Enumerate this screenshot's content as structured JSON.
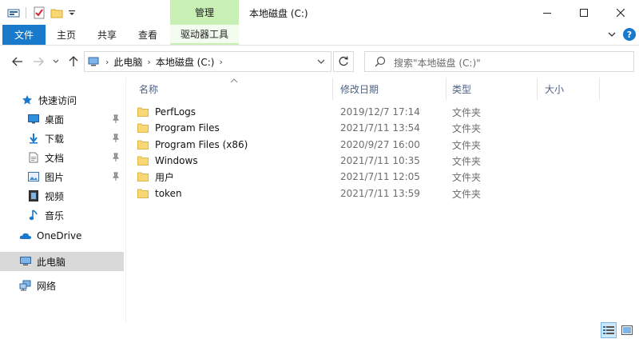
{
  "colors": {
    "file_tab": "#1979ca",
    "manage_tab": "#c8f0b4",
    "selected_item": "#d9d9d9",
    "folder_yellow": "#f8d775",
    "column_header": "#4d6082"
  },
  "titlebar": {
    "quick_access_icons": [
      "properties-icon",
      "checkmark-icon",
      "new-folder-icon",
      "customize-dropdown-icon"
    ],
    "context_tab": "管理",
    "title": "本地磁盘 (C:)",
    "buttons": [
      "minimize-icon",
      "maximize-icon",
      "close-icon"
    ]
  },
  "ribbon": {
    "tabs": [
      "文件",
      "主页",
      "共享",
      "查看",
      "驱动器工具"
    ]
  },
  "navbar": {
    "breadcrumbs": [
      "此电脑",
      "本地磁盘 (C:)"
    ],
    "search_placeholder": "搜索\"本地磁盘 (C:)\""
  },
  "sidebar": {
    "items": [
      {
        "label": "快速访问",
        "icon": "star-icon",
        "pinned": false
      },
      {
        "label": "桌面",
        "icon": "desktop-icon",
        "pinned": true
      },
      {
        "label": "下载",
        "icon": "download-icon",
        "pinned": true
      },
      {
        "label": "文档",
        "icon": "document-icon",
        "pinned": true
      },
      {
        "label": "图片",
        "icon": "picture-icon",
        "pinned": true
      },
      {
        "label": "视频",
        "icon": "video-icon",
        "pinned": false
      },
      {
        "label": "音乐",
        "icon": "music-icon",
        "pinned": false
      },
      {
        "label": "OneDrive",
        "icon": "cloud-icon",
        "pinned": false
      },
      {
        "label": "此电脑",
        "icon": "computer-icon",
        "pinned": false,
        "selected": true
      },
      {
        "label": "网络",
        "icon": "network-icon",
        "pinned": false
      }
    ]
  },
  "table": {
    "columns": [
      "名称",
      "修改日期",
      "类型",
      "大小"
    ],
    "rows": [
      {
        "name": "PerfLogs",
        "date": "2019/12/7 17:14",
        "type": "文件夹"
      },
      {
        "name": "Program Files",
        "date": "2021/7/11 13:54",
        "type": "文件夹"
      },
      {
        "name": "Program Files (x86)",
        "date": "2020/9/27 16:00",
        "type": "文件夹"
      },
      {
        "name": "Windows",
        "date": "2021/7/11 10:35",
        "type": "文件夹"
      },
      {
        "name": "用户",
        "date": "2021/7/11 12:05",
        "type": "文件夹"
      },
      {
        "name": "token",
        "date": "2021/7/11 13:59",
        "type": "文件夹"
      }
    ]
  }
}
